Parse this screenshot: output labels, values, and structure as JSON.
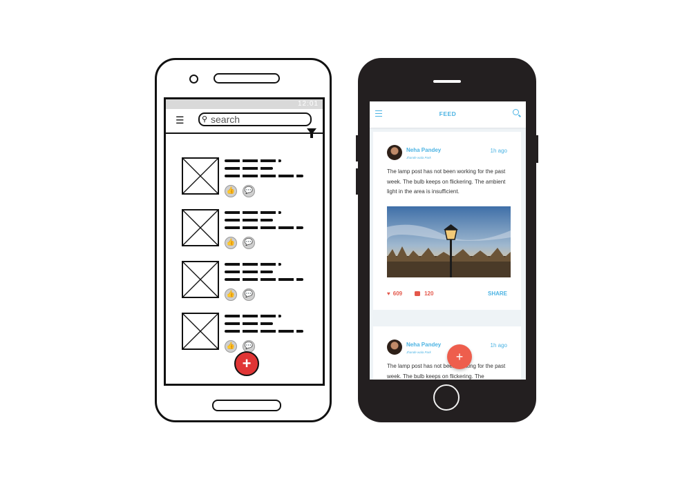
{
  "wireframe": {
    "status_time": "12:01",
    "search_placeholder": "search",
    "item_count": 4
  },
  "app": {
    "header_title": "FEED",
    "posts": [
      {
        "author": "Neha Pandey",
        "location": "Jhande wala Park",
        "time": "1h ago",
        "text": "The lamp post has not been working for the past week. The bulb keeps on flickering. The ambient light in the area is insufficient.",
        "likes": "609",
        "comments": "120",
        "share_label": "SHARE"
      },
      {
        "author": "Neha Pandey",
        "location": "Jhande wala Park",
        "time": "1h ago",
        "text": "The lamp post has not been working for the past week. The bulb keeps on flickering. The"
      }
    ],
    "fab_label": "+"
  },
  "colors": {
    "accent_blue": "#4bb3e3",
    "accent_red": "#e4574a",
    "wireframe_fab": "#e03535"
  }
}
